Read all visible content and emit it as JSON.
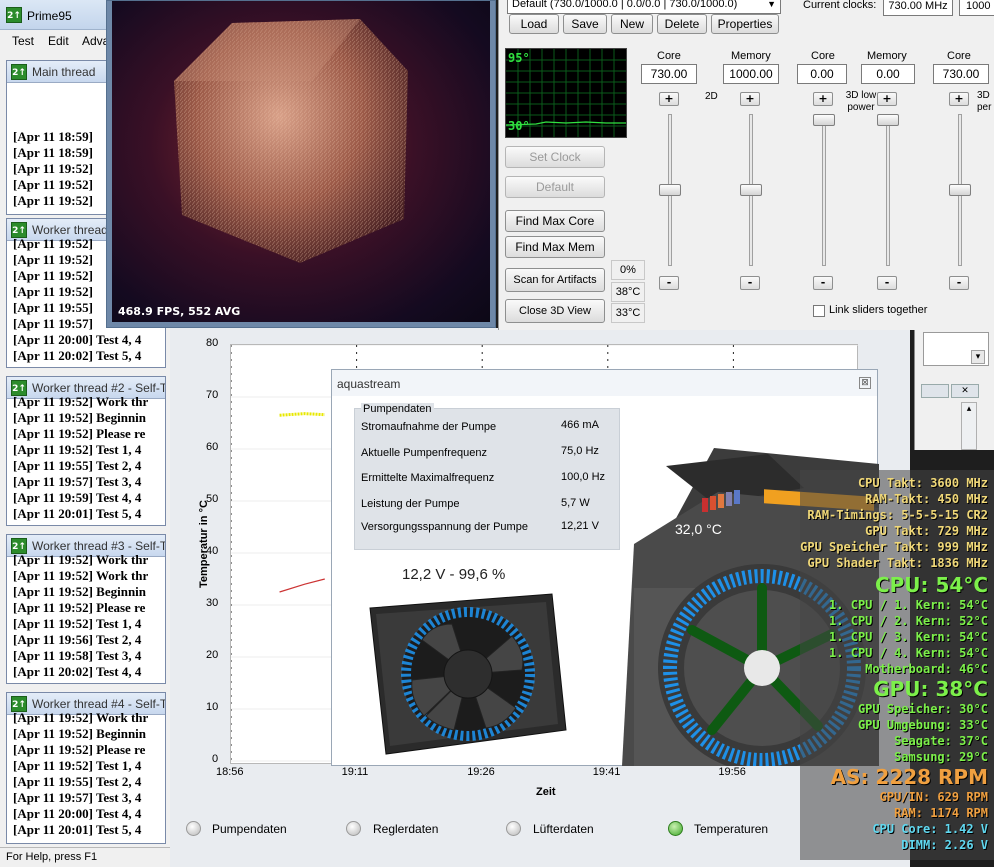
{
  "prime95": {
    "title": "Prime95",
    "menu": [
      "Test",
      "Edit",
      "Adva"
    ],
    "status": "For Help, press F1",
    "windows": [
      {
        "caption": "Main thread",
        "lines": [
          "[Apr 11 18:59]",
          "[Apr 11 18:59]",
          "[Apr 11 19:52]",
          "[Apr 11 19:52]",
          "[Apr 11 19:52]"
        ]
      },
      {
        "caption": "Worker thread",
        "lines": [
          "[Apr 11 19:52]",
          "[Apr 11 19:52]",
          "[Apr 11 19:52]",
          "[Apr 11 19:52]",
          "[Apr 11 19:55]",
          "[Apr 11 19:57]",
          "[Apr 11 20:00] Test 4, 4",
          "[Apr 11 20:02] Test 5, 4"
        ]
      },
      {
        "caption": "Worker thread #2 - Self-T",
        "lines": [
          "[Apr 11 19:52] Work thr",
          "[Apr 11 19:52] Beginnin",
          "[Apr 11 19:52] Please re",
          "[Apr 11 19:52] Test 1, 4",
          "[Apr 11 19:55] Test 2, 4",
          "[Apr 11 19:57] Test 3, 4",
          "[Apr 11 19:59] Test 4, 4",
          "[Apr 11 20:01] Test 5, 4"
        ]
      },
      {
        "caption": "Worker thread #3 - Self-T",
        "lines": [
          "[Apr 11 19:52] Work thr",
          "[Apr 11 19:52] Work thr",
          "[Apr 11 19:52] Beginnin",
          "[Apr 11 19:52] Please re",
          "[Apr 11 19:52] Test 1, 4",
          "[Apr 11 19:56] Test 2, 4",
          "[Apr 11 19:58] Test 3, 4",
          "[Apr 11 20:02] Test 4, 4"
        ]
      },
      {
        "caption": "Worker thread #4 - Self-T",
        "lines": [
          "[Apr 11 19:52] Work thr",
          "[Apr 11 19:52] Beginnin",
          "[Apr 11 19:52] Please re",
          "[Apr 11 19:52] Test 1, 4",
          "[Apr 11 19:55] Test 2, 4",
          "[Apr 11 19:57] Test 3, 4",
          "[Apr 11 20:00] Test 4, 4",
          "[Apr 11 20:01] Test 5, 4"
        ]
      }
    ]
  },
  "fur": {
    "fps": "468.9 FPS, 552 AVG"
  },
  "oc": {
    "profile": "Default (730.0/1000.0 | 0.0/0.0 | 730.0/1000.0)",
    "current_clocks_label": "Current clocks:",
    "current_clocks_value": "730.00 MHz",
    "current_clocks_extra": "1000",
    "buttons": {
      "load": "Load",
      "save": "Save",
      "new": "New",
      "delete": "Delete",
      "properties": "Properties",
      "set_clock": "Set Clock",
      "default": "Default",
      "find_max_core": "Find Max Core",
      "find_max_mem": "Find Max Mem",
      "scan": "Scan for Artifacts",
      "close3d": "Close 3D View"
    },
    "monitor": {
      "top": "95°",
      "bottom": "30°"
    },
    "readouts": [
      "0%",
      "38°C",
      "33°C"
    ],
    "cols": [
      {
        "label": "Core",
        "value": "730.00"
      },
      {
        "label": "Memory",
        "value": "1000.00"
      },
      {
        "label": "Core",
        "value": "0.00"
      },
      {
        "label": "Memory",
        "value": "0.00"
      },
      {
        "label": "Core",
        "value": "730.00"
      }
    ],
    "mode_2d": "2D",
    "mode_low": "3D low power",
    "mode_3d": "3D",
    "mode_3d_extra": "per",
    "plus": "+",
    "minus": "-",
    "link": "Link sliders together"
  },
  "chart_data": {
    "type": "line",
    "xlabel": "Zeit",
    "ylabel": "Temperatur in °C",
    "ylim": [
      0,
      80
    ],
    "yticks": [
      "80",
      "70",
      "60",
      "50",
      "40",
      "30",
      "20",
      "10",
      "0"
    ],
    "xticks": [
      "18:56",
      "19:11",
      "19:26",
      "19:41",
      "19:56"
    ],
    "series": [
      {
        "color": "#e8e800",
        "values": [
          [
            19.03,
            66.5
          ],
          [
            19.08,
            66.8
          ],
          [
            19.12,
            66.6
          ]
        ]
      },
      {
        "color": "#cc3333",
        "values": [
          [
            19.03,
            32.5
          ],
          [
            19.08,
            34.0
          ],
          [
            19.12,
            35.0
          ]
        ]
      }
    ]
  },
  "tabs": [
    {
      "label": "Pumpendaten",
      "active": false
    },
    {
      "label": "Reglerdaten",
      "active": false
    },
    {
      "label": "Lüfterdaten",
      "active": false
    },
    {
      "label": "Temperaturen",
      "active": true
    }
  ],
  "aqua": {
    "title": "aquastream",
    "group": "Pumpendaten",
    "rows": [
      {
        "label": "Stromaufnahme der Pumpe",
        "value": "466 mA"
      },
      {
        "label": "Aktuelle Pumpenfrequenz",
        "value": "75,0 Hz"
      },
      {
        "label": "Ermittelte Maximalfrequenz",
        "value": "100,0 Hz"
      },
      {
        "label": "Leistung der Pumpe",
        "value": "5,7 W"
      },
      {
        "label": "Versorgungsspannung der Pumpe",
        "value": "12,21 V"
      }
    ],
    "fan_label": "12,2 V - 99,6 %",
    "pump_temp": "32,0 °C"
  },
  "osd": {
    "lines": [
      {
        "text": "CPU Takt: 3600 MHz",
        "color": "#f0d878"
      },
      {
        "text": "RAM-Takt: 450 MHz",
        "color": "#f0d878"
      },
      {
        "text": "RAM-Timings: 5-5-5-15 CR2",
        "color": "#f0d878"
      },
      {
        "text": "GPU Takt: 729 MHz",
        "color": "#f0d878"
      },
      {
        "text": "GPU Speicher Takt: 999 MHz",
        "color": "#f0d878"
      },
      {
        "text": "GPU Shader Takt: 1836 MHz",
        "color": "#f0d878"
      }
    ],
    "cpu_big": "CPU: 54°C",
    "cpu_lines": [
      "1. CPU / 1. Kern: 54°C",
      "1. CPU / 2. Kern: 52°C",
      "1. CPU / 3. Kern: 54°C",
      "1. CPU / 4. Kern: 54°C",
      "Motherboard: 46°C"
    ],
    "gpu_big": "GPU: 38°C",
    "gpu_lines": [
      "GPU Speicher: 30°C",
      "GPU Umgebung: 33°C",
      "Seagate: 37°C",
      "Samsung: 29°C"
    ],
    "as_big": "AS: 2228 RPM",
    "as_lines": [
      "GPU/IN: 629 RPM",
      "RAM: 1174 RPM"
    ],
    "volt_lines": [
      "CPU Core: 1.42 V",
      "DIMM: 2.26 V"
    ],
    "colors": {
      "green": "#7cf04a",
      "orange": "#f0a040",
      "cyan": "#60d8f0"
    }
  }
}
